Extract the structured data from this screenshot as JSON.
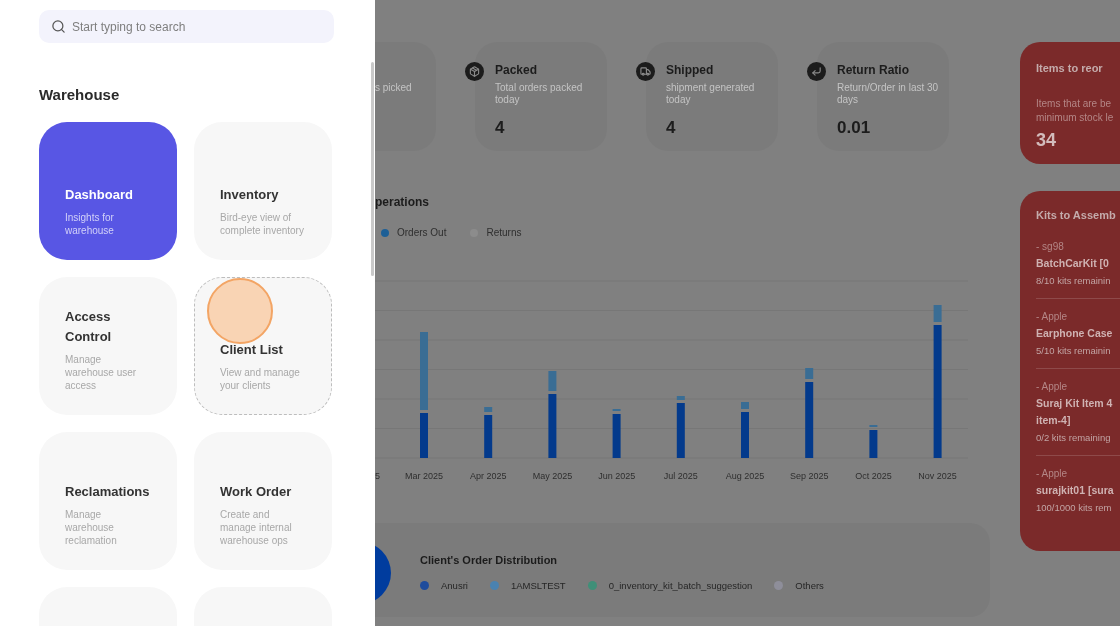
{
  "drawer": {
    "search": {
      "placeholder": "Start typing to search"
    },
    "section_title": "Warehouse",
    "tiles": [
      {
        "kind": "link",
        "title": "Dashboard",
        "description": "Insights for\nwarehouse",
        "selected": true,
        "focused": false
      },
      {
        "kind": "link",
        "title": "Inventory",
        "description": "Bird-eye view of\ncomplete inventory",
        "selected": false,
        "focused": false
      },
      {
        "kind": "link",
        "title": "Access\nControl",
        "description": "Manage\nwarehouse user\naccess",
        "selected": false,
        "focused": false
      },
      {
        "kind": "link",
        "title": "Client List",
        "description": "View and manage\nyour clients",
        "selected": false,
        "focused": true
      },
      {
        "kind": "link",
        "title": "Reclamations",
        "description": "Manage\nwarehouse\nreclamation",
        "selected": false,
        "focused": false
      },
      {
        "kind": "link",
        "title": "Work Order",
        "description": "Create and\nmanage internal\nwarehouse ops",
        "selected": false,
        "focused": false
      },
      {
        "kind": "cut_off"
      },
      {
        "kind": "cut_off"
      }
    ]
  },
  "stat_cards": [
    {
      "kind": "cut_off",
      "description": "s picked"
    },
    {
      "kind": "full",
      "title": "Packed",
      "description": "Total orders packed\ntoday",
      "value": "4"
    },
    {
      "kind": "full",
      "title": "Shipped",
      "description": "shipment generated\ntoday",
      "value": "4"
    },
    {
      "kind": "full",
      "title": "Return Ratio",
      "description": "Return/Order in last 30\ndays",
      "value": "0.01"
    }
  ],
  "operations_chart": {
    "title": "perations",
    "legend": [
      {
        "label": "Orders Out",
        "color": "#1d5f96"
      },
      {
        "label": "Returns",
        "color": "#8c8c8c"
      }
    ],
    "x_labels": [
      "5",
      "Mar 2025",
      "Apr 2025",
      "May 2025",
      "Jun 2025",
      "Jul 2025",
      "Aug 2025",
      "Sep 2025",
      "Oct 2025",
      "Nov 2025"
    ]
  },
  "client_distribution": {
    "title": "Client's Order Distribution",
    "legend": [
      {
        "label": "Anusri",
        "color": "#1e4c9c"
      },
      {
        "label": "1AMSLTEST",
        "color": "#4a82b0"
      },
      {
        "label": "0_inventory_kit_batch_suggestion",
        "color": "#3f8f78"
      },
      {
        "label": "Others",
        "color": "#8e8e9a"
      }
    ]
  },
  "reorder_card": {
    "title": "Items to reor",
    "description": "Items that are be\nminimum stock le",
    "value": "34"
  },
  "kits_card": {
    "title": "Kits to Assemb",
    "items": [
      {
        "client": "- sg98",
        "name": "BatchCarKit [0",
        "remaining": "8/10 kits remainin"
      },
      {
        "client": "- Apple",
        "name": "Earphone Case",
        "remaining": "5/10 kits remainin"
      },
      {
        "client": "- Apple",
        "name": "Suraj Kit Item 4\nitem-4]",
        "remaining": "0/2 kits remaining"
      },
      {
        "client": "- Apple",
        "name": "surajkit01 [sura",
        "remaining": "100/1000 kits rem"
      }
    ]
  }
}
